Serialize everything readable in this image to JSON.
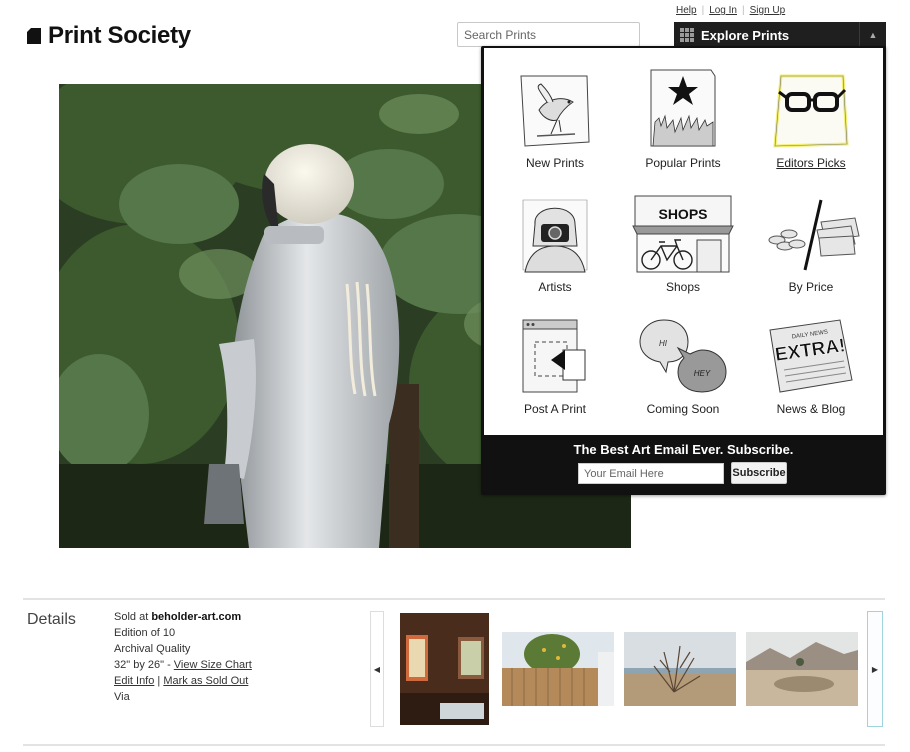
{
  "header": {
    "logo_text": "Print Society",
    "links": [
      "Help",
      "Log In",
      "Sign Up"
    ],
    "search_placeholder": "Search Prints",
    "explore_label": "Explore Prints"
  },
  "explore_menu": {
    "items": [
      {
        "label": "New Prints",
        "icon": "bird-icon"
      },
      {
        "label": "Popular Prints",
        "icon": "crowd-star-icon"
      },
      {
        "label": "Editors Picks",
        "icon": "glasses-icon",
        "active": true
      },
      {
        "label": "Artists",
        "icon": "camera-artist-icon"
      },
      {
        "label": "Shops",
        "icon": "storefront-icon"
      },
      {
        "label": "By Price",
        "icon": "money-icon"
      },
      {
        "label": "Post A Print",
        "icon": "post-print-icon"
      },
      {
        "label": "Coming Soon",
        "icon": "speech-bubbles-icon"
      },
      {
        "label": "News & Blog",
        "icon": "newspaper-icon"
      }
    ],
    "shops_sign": "SHOPS",
    "bubble_hi": "HI",
    "bubble_hey": "HEY",
    "newspaper_headline": "EXTRA!",
    "newspaper_masthead": "DAILY NEWS",
    "subscribe_title": "The Best Art Email Ever. Subscribe.",
    "email_placeholder": "Your Email Here",
    "subscribe_button": "Subscribe"
  },
  "details": {
    "heading": "Details",
    "sold_at_prefix": "Sold at ",
    "sold_at_site": "beholder-art.com",
    "edition": "Edition of 10",
    "quality": "Archival Quality",
    "size": "32\" by  26\" - ",
    "size_chart_link": "View Size Chart",
    "edit_info_link": "Edit Info",
    "mark_sold_link": "Mark as Sold Out",
    "via": "Via"
  },
  "carousel": {
    "prev_icon": "triangle-left-icon",
    "next_icon": "triangle-right-icon"
  },
  "colors": {
    "dark": "#111111",
    "accent_border": "#9fd4de",
    "highlight": "#f2ee70"
  }
}
